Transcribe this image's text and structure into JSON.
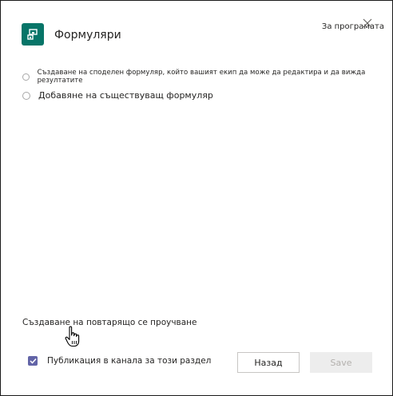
{
  "app": {
    "title": "Формуляри",
    "icon": "forms-app-icon",
    "icon_color": "#077568"
  },
  "header": {
    "about_label": "За програмата",
    "close_icon": "close-icon"
  },
  "options": [
    {
      "label": "Създаване на споделен формуляр, който вашият екип да може да редактира и да вижда резултатите",
      "selected": false
    },
    {
      "label": "Добавяне на съществуващ формуляр",
      "selected": false
    }
  ],
  "recurring_link": "Създаване на повтарящо се проучване",
  "footer": {
    "post_to_channel_label": "Публикация в канала за този раздел",
    "post_to_channel_checked": true,
    "back_label": "Назад",
    "save_label": "Save",
    "accent_color": "#6264a7"
  }
}
